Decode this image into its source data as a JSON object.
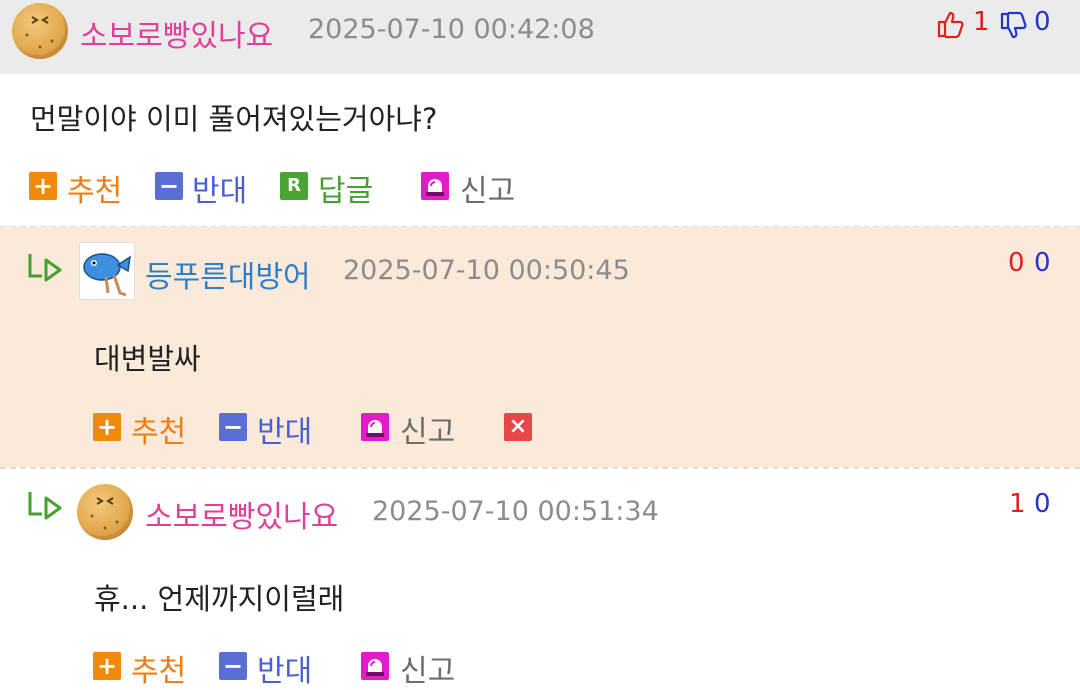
{
  "comments": [
    {
      "nickname": "소보로빵있나요",
      "timestamp": "2025-07-10 00:42:08",
      "body": "먼말이야 이미 풀어져있는거아냐?",
      "likes": "1",
      "dislikes": "0",
      "actions": {
        "recommend": "추천",
        "oppose": "반대",
        "reply": "답글",
        "report": "신고"
      }
    },
    {
      "nickname": "등푸른대방어",
      "timestamp": "2025-07-10 00:50:45",
      "body": "대변발싸",
      "likes": "0",
      "dislikes": "0",
      "actions": {
        "recommend": "추천",
        "oppose": "반대",
        "report": "신고"
      }
    },
    {
      "nickname": "소보로빵있나요",
      "timestamp": "2025-07-10 00:51:34",
      "body": "휴... 언제까지이럴래",
      "likes": "1",
      "dislikes": "0",
      "actions": {
        "recommend": "추천",
        "oppose": "반대",
        "report": "신고"
      }
    }
  ],
  "icons": {
    "plus": "+",
    "minus": "−",
    "reply": "R",
    "delete": "×"
  },
  "colors": {
    "recommend": "#ef7f10",
    "oppose": "#4a5fd0",
    "reply": "#46a131",
    "report_icon": "#e01dc8",
    "delete_icon": "#e84747",
    "nick_pink": "#e0409a",
    "nick_blue": "#2f7fc8",
    "reply_bg": "#fbe9d9",
    "header_bg": "#ebebeb"
  }
}
